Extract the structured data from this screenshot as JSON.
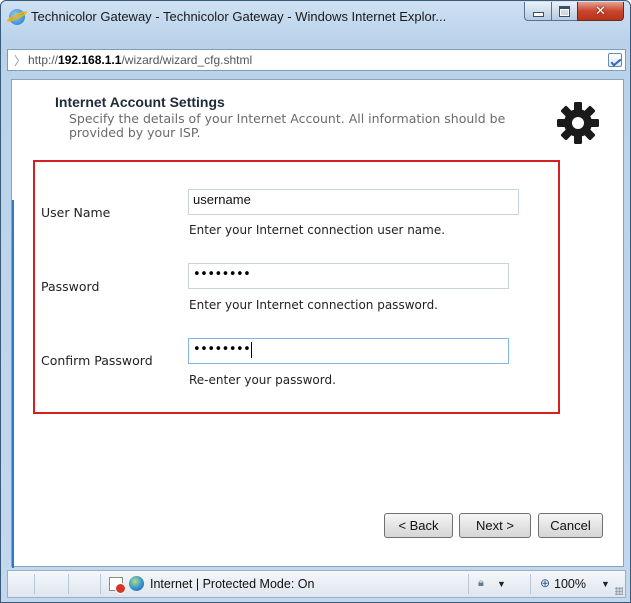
{
  "window": {
    "title": "Technicolor Gateway - Technicolor Gateway - Windows Internet Explor..."
  },
  "address": {
    "prefix": "http://",
    "host": "192.168.1.1",
    "path": "/wizard/wizard_cfg.shtml"
  },
  "page": {
    "heading": "Internet Account Settings",
    "description": "Specify the details of your Internet Account. All information should be provided by your ISP.",
    "fields": [
      {
        "label": "User Name",
        "value": "username",
        "hint": "Enter your Internet connection user name."
      },
      {
        "label": "Password",
        "value": "••••••••",
        "hint": "Enter your Internet connection password."
      },
      {
        "label": "Confirm Password",
        "value": "••••••••",
        "hint": "Re-enter your password."
      }
    ]
  },
  "buttons": {
    "back": "< Back",
    "next": "Next >",
    "cancel": "Cancel"
  },
  "status": {
    "zone": "Internet | Protected Mode: On",
    "zoom": "100%"
  },
  "icons": {
    "app": "ie-icon",
    "settings": "gear-icon",
    "compat": "compat-view-icon",
    "status_warning": "blocked-content-icon",
    "zone": "globe-icon"
  },
  "colors": {
    "highlight_border": "#d42020",
    "titlebar": "#b9d2ea",
    "close_button": "#c9462c"
  }
}
